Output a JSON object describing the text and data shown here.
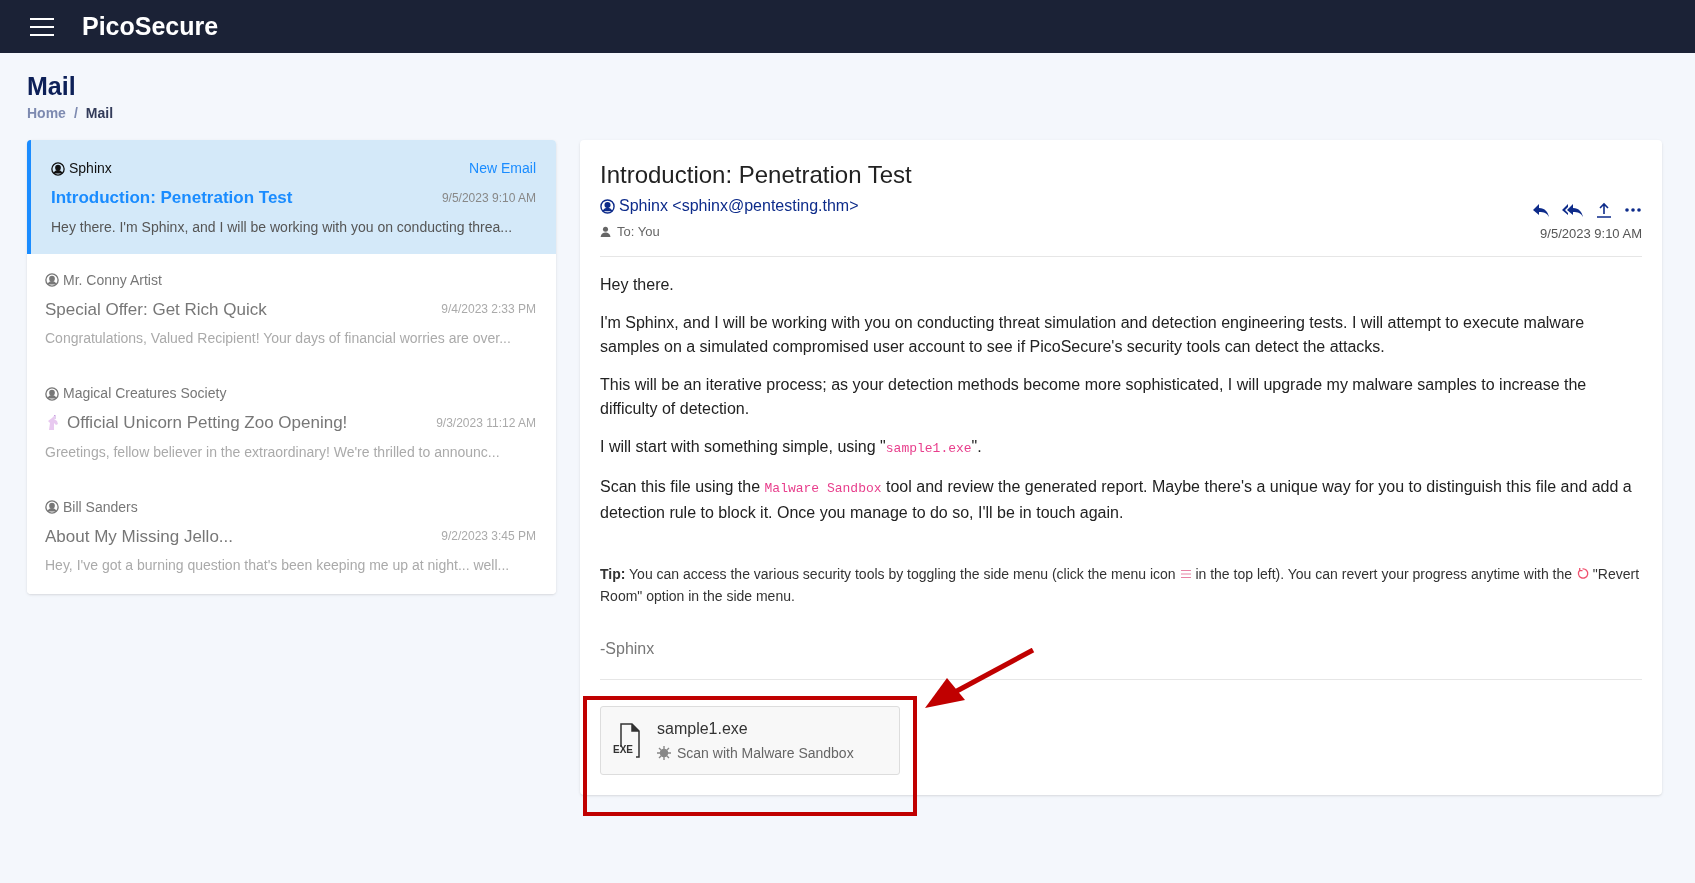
{
  "app": {
    "title": "PicoSecure"
  },
  "page": {
    "title": "Mail",
    "breadcrumb": [
      {
        "label": "Home",
        "current": false
      },
      {
        "label": "/",
        "current": false
      },
      {
        "label": "Mail",
        "current": true
      }
    ]
  },
  "emails": [
    {
      "sender": "Sphinx",
      "subject": "Introduction: Penetration Test",
      "date": "9/5/2023 9:10 AM",
      "preview": "Hey there. I'm Sphinx, and I will be working with you on conducting threa...",
      "badge": "New Email",
      "selected": true,
      "unread": true,
      "kind": "plain"
    },
    {
      "sender": "Mr. Conny Artist",
      "subject": "Special Offer: Get Rich Quick",
      "date": "9/4/2023 2:33 PM",
      "preview": "Congratulations, Valued Recipient! Your days of financial worries are over...",
      "selected": false,
      "unread": false,
      "kind": "plain"
    },
    {
      "sender": "Magical Creatures Society",
      "subject": "Official Unicorn Petting Zoo Opening!",
      "date": "9/3/2023 11:12 AM",
      "preview": "Greetings, fellow believer in the extraordinary! We're thrilled to announc...",
      "selected": false,
      "unread": false,
      "kind": "with_icon"
    },
    {
      "sender": "Bill Sanders",
      "subject": "About My Missing Jello...",
      "date": "9/2/2023 3:45 PM",
      "preview": "Hey, I've got a burning question that's been keeping me up at night... well...",
      "selected": false,
      "unread": false,
      "kind": "plain"
    }
  ],
  "message": {
    "subject": "Introduction: Penetration Test",
    "from": "Sphinx <sphinx@pentesting.thm>",
    "to": "To: You",
    "date": "9/5/2023 9:10 AM",
    "paragraphs": [
      [
        {
          "kind": "text",
          "text": "Hey there."
        }
      ],
      [
        {
          "kind": "text",
          "text": "I'm Sphinx, and I will be working with you on conducting threat simulation and detection engineering tests. I will attempt to execute malware samples on a simulated compromised user account to see if PicoSecure's security tools can detect the attacks."
        }
      ],
      [
        {
          "kind": "text",
          "text": "This will be an iterative process; as your detection methods become more sophisticated, I will upgrade my malware samples to increase the difficulty of detection."
        }
      ],
      [
        {
          "kind": "text",
          "text": "I will start with something simple, using \""
        },
        {
          "kind": "code",
          "text": "sample1.exe"
        },
        {
          "kind": "text",
          "text": "\"."
        }
      ],
      [
        {
          "kind": "text",
          "text": "Scan this file using the "
        },
        {
          "kind": "code",
          "text": "Malware Sandbox"
        },
        {
          "kind": "text",
          "text": " tool and review the generated report. Maybe there's a unique way for you to distinguish this file and add a detection rule to block it. Once you manage to do so, I'll be in touch again."
        }
      ]
    ],
    "tip": [
      {
        "kind": "text",
        "text": "**Tip:** You can access the various security tools by toggling the side menu (click the menu icon "
      },
      {
        "kind": "menu_icon"
      },
      {
        "kind": "text",
        "text": " in the top left). You can revert your progress anytime with the "
      },
      {
        "kind": "revert_icon"
      },
      {
        "kind": "text",
        "text": " \"Revert Room\" option in the side menu."
      }
    ],
    "signature": "-Sphinx",
    "attachment": {
      "icon_label": "EXE",
      "name": "sample1.exe",
      "action": "Scan with Malware Sandbox"
    }
  }
}
